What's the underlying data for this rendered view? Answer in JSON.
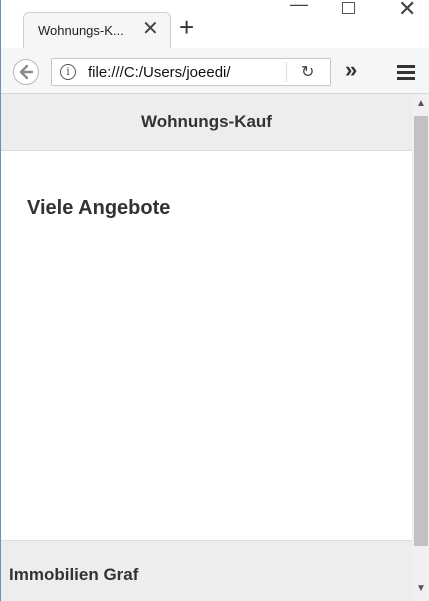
{
  "browser": {
    "tab": {
      "title": "Wohnungs-K...",
      "close_icon": "close-icon"
    },
    "new_tab_icon": "plus-icon",
    "window_controls": {
      "minimize": "minimize-icon",
      "maximize": "maximize-icon",
      "close": "close-icon"
    },
    "navbar": {
      "back_icon": "back-arrow-icon",
      "info_icon": "info-icon",
      "info_glyph": "i",
      "url": "file:///C:/Users/joeedi/",
      "reload_icon": "reload-icon",
      "overflow_icon": "chevron-double-right-icon",
      "menu_icon": "hamburger-menu-icon"
    }
  },
  "page": {
    "header": {
      "title": "Wohnungs-Kauf"
    },
    "main": {
      "heading": "Viele Angebote"
    },
    "footer": {
      "text": "Immobilien Graf"
    }
  },
  "colors": {
    "header_bg": "#ededed",
    "footer_bg": "#ededed",
    "text": "#333333",
    "toolbar_bg": "#f5f6f7"
  }
}
